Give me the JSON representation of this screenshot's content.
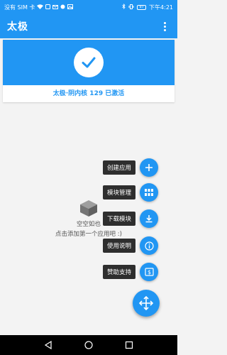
{
  "status_bar": {
    "carrier": "没有 SIM 卡",
    "battery": "97",
    "time": "下午4:21"
  },
  "app_bar": {
    "title": "太极"
  },
  "status_card": {
    "text": "太极·阴内核 129 已激活"
  },
  "empty_state": {
    "title": "空空如也",
    "subtitle": "点击添加第一个应用吧 :)"
  },
  "fab_menu": {
    "items": [
      {
        "label": "创建应用",
        "icon": "plus-icon"
      },
      {
        "label": "模块管理",
        "icon": "grid-icon"
      },
      {
        "label": "下载模块",
        "icon": "download-icon"
      },
      {
        "label": "使用说明",
        "icon": "info-icon"
      },
      {
        "label": "赞助支持",
        "icon": "donate-icon"
      }
    ],
    "main_icon": "move-arrows-icon"
  },
  "colors": {
    "primary": "#2196f3",
    "label_bg": "#2e2e2e"
  }
}
